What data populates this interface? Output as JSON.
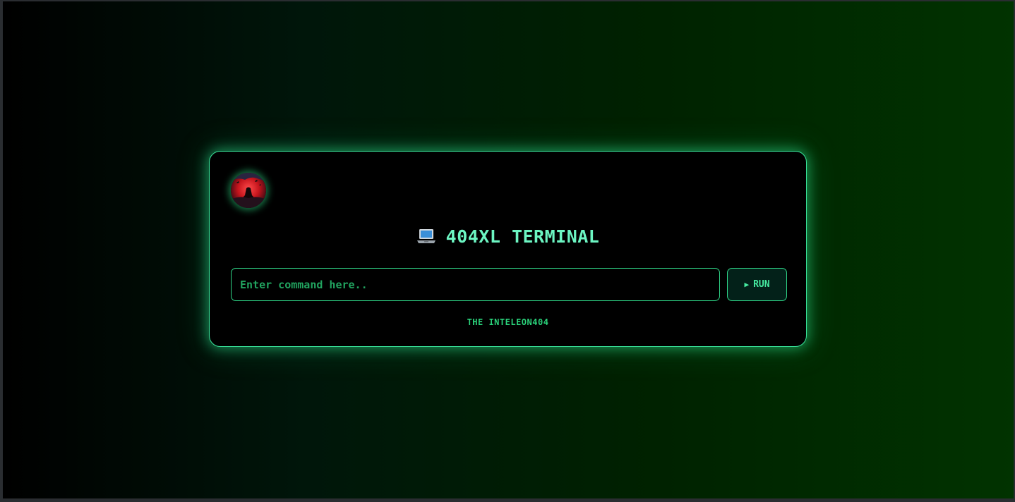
{
  "terminal": {
    "avatar_icon": "red-moon-samurai-avatar",
    "title_icon": "laptop-icon",
    "title": "404XL TERMINAL",
    "input": {
      "value": "",
      "placeholder": "Enter command here.."
    },
    "run_button": {
      "icon": "play-icon",
      "label": "RUN"
    },
    "footer": "THE INTELEON404"
  },
  "colors": {
    "accent": "#39e39a",
    "title": "#6cf5c2",
    "background_start": "#000000",
    "background_end": "#013300"
  }
}
